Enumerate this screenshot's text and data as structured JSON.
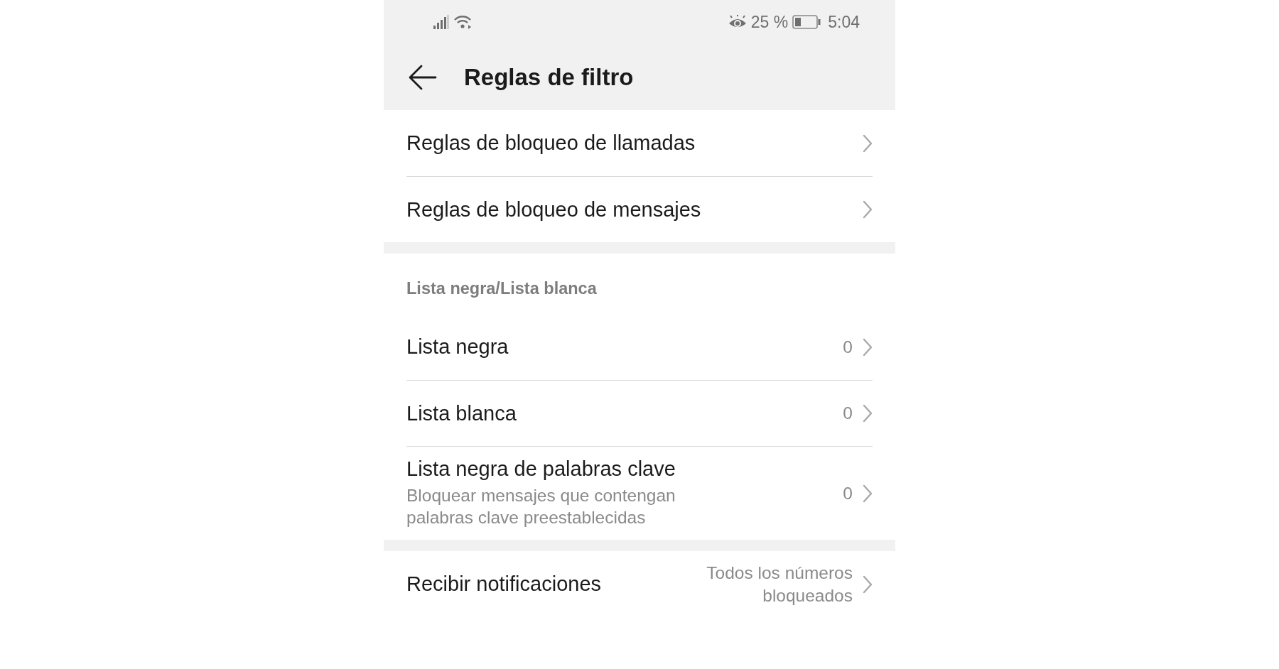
{
  "status_bar": {
    "battery_percent": "25 %",
    "time": "5:04"
  },
  "header": {
    "title": "Reglas de filtro"
  },
  "sections": [
    {
      "items": [
        {
          "title": "Reglas de bloqueo de llamadas"
        },
        {
          "title": "Reglas de bloqueo de mensajes"
        }
      ]
    },
    {
      "heading": "Lista negra/Lista blanca",
      "items": [
        {
          "title": "Lista negra",
          "value": "0"
        },
        {
          "title": "Lista blanca",
          "value": "0"
        },
        {
          "title": "Lista negra de palabras clave",
          "subtitle": "Bloquear mensajes que contengan palabras clave preestablecidas",
          "value": "0"
        }
      ]
    },
    {
      "items": [
        {
          "title": "Recibir notificaciones",
          "value": "Todos los números bloqueados"
        }
      ]
    }
  ]
}
